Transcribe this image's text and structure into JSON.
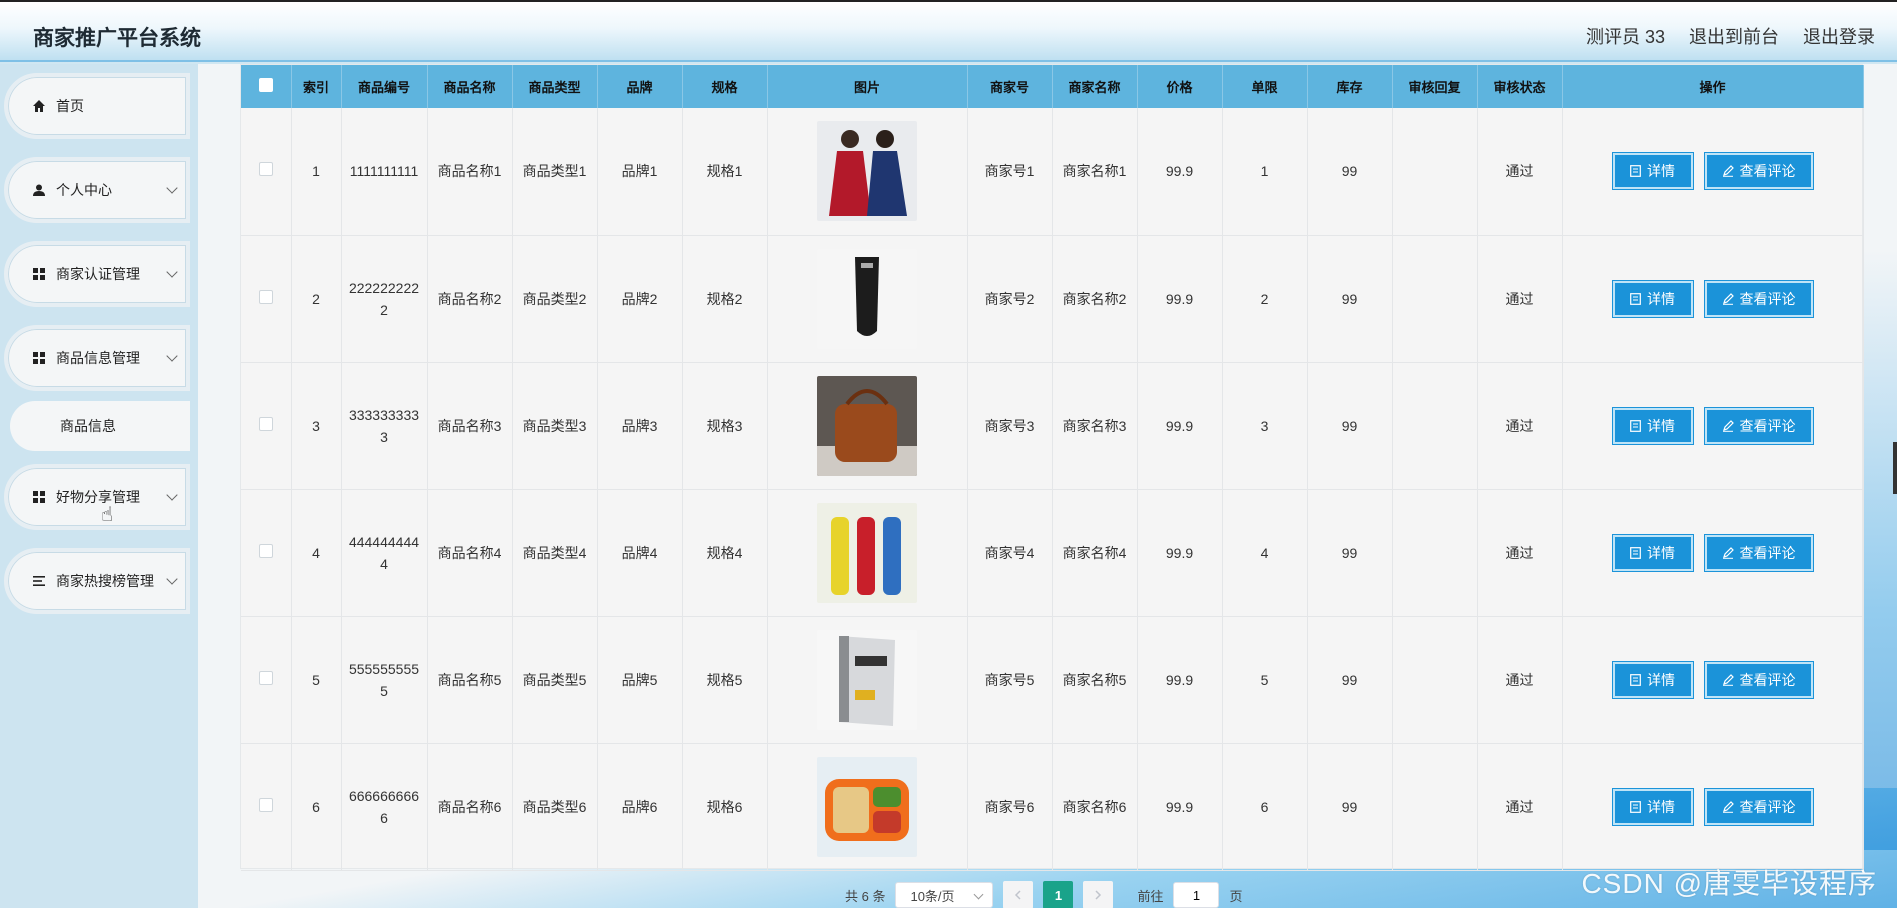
{
  "header": {
    "title": "商家推广平台系统",
    "user": "测评员 33",
    "to_front": "退出到前台",
    "logout": "退出登录"
  },
  "sidebar": {
    "items": [
      {
        "label": "首页",
        "icon": "home-icon"
      },
      {
        "label": "个人中心",
        "icon": "user-icon"
      },
      {
        "label": "商家认证管理",
        "icon": "grid-icon"
      },
      {
        "label": "商品信息管理",
        "icon": "grid-icon"
      },
      {
        "label": "商品信息",
        "icon": ""
      },
      {
        "label": "好物分享管理",
        "icon": "grid-icon"
      },
      {
        "label": "商家热搜榜管理",
        "icon": "list-icon"
      }
    ]
  },
  "table": {
    "headers": [
      "索引",
      "商品编号",
      "商品名称",
      "商品类型",
      "品牌",
      "规格",
      "图片",
      "商家号",
      "商家名称",
      "价格",
      "单限",
      "库存",
      "审核回复",
      "审核状态",
      "操作"
    ],
    "rows": [
      {
        "index": "1",
        "code": "1111111111",
        "name": "商品名称1",
        "type": "商品类型1",
        "brand": "品牌1",
        "spec": "规格1",
        "image": "dresses-image",
        "merchant_no": "商家号1",
        "merchant_name": "商家名称1",
        "price": "99.9",
        "limit": "1",
        "stock": "99",
        "reply": "",
        "status": "通过"
      },
      {
        "index": "2",
        "code": "2222222222",
        "name": "商品名称2",
        "type": "商品类型2",
        "brand": "品牌2",
        "spec": "规格2",
        "image": "cosmetic-tube-image",
        "merchant_no": "商家号2",
        "merchant_name": "商家名称2",
        "price": "99.9",
        "limit": "2",
        "stock": "99",
        "reply": "",
        "status": "通过"
      },
      {
        "index": "3",
        "code": "3333333333",
        "name": "商品名称3",
        "type": "商品类型3",
        "brand": "品牌3",
        "spec": "规格3",
        "image": "bag-image",
        "merchant_no": "商家号3",
        "merchant_name": "商家名称3",
        "price": "99.9",
        "limit": "3",
        "stock": "99",
        "reply": "",
        "status": "通过"
      },
      {
        "index": "4",
        "code": "4444444444",
        "name": "商品名称4",
        "type": "商品类型4",
        "brand": "品牌4",
        "spec": "规格4",
        "image": "bottles-image",
        "merchant_no": "商家号4",
        "merchant_name": "商家名称4",
        "price": "99.9",
        "limit": "4",
        "stock": "99",
        "reply": "",
        "status": "通过"
      },
      {
        "index": "5",
        "code": "5555555555",
        "name": "商品名称5",
        "type": "商品类型5",
        "brand": "品牌5",
        "spec": "规格5",
        "image": "book-image",
        "merchant_no": "商家号5",
        "merchant_name": "商家名称5",
        "price": "99.9",
        "limit": "5",
        "stock": "99",
        "reply": "",
        "status": "通过"
      },
      {
        "index": "6",
        "code": "6666666666",
        "name": "商品名称6",
        "type": "商品类型6",
        "brand": "品牌6",
        "spec": "规格6",
        "image": "lunchbox-image",
        "merchant_no": "商家号6",
        "merchant_name": "商家名称6",
        "price": "99.9",
        "limit": "6",
        "stock": "99",
        "reply": "",
        "status": "通过"
      }
    ],
    "actions": {
      "detail": "详情",
      "review": "查看评论"
    }
  },
  "pagination": {
    "total": "共 6 条",
    "page_size": "10条/页",
    "current": "1",
    "goto_prefix": "前往",
    "goto_value": "1",
    "goto_suffix": "页"
  },
  "watermark": "CSDN @唐雯毕设程序",
  "colors": {
    "header_bg": "#5eb4de",
    "button": "#1b93d9",
    "page_active": "#1aa38a"
  }
}
